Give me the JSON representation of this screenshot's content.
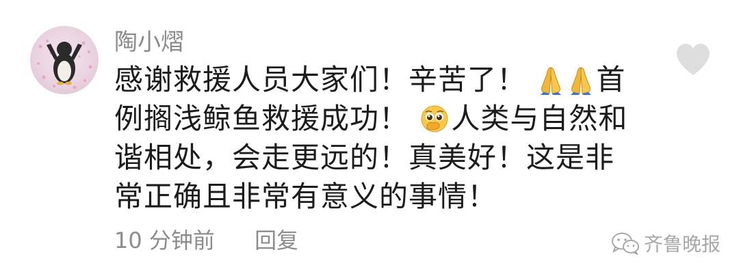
{
  "comment": {
    "username": "陶小熠",
    "text_parts": {
      "p1": "感谢救援人员大家们！辛苦了！",
      "p2": "首例搁浅鲸鱼救援成功！",
      "p3": "人类与自然和谐相处，会走更远的！真美好！这是非常正确且非常有意义的事情！"
    },
    "emojis": {
      "pray": "folded-hands",
      "moved": "pleading-face-hand-over-mouth"
    },
    "time": "10 分钟前",
    "reply_label": "回复",
    "like_icon": "heart-outline"
  },
  "watermark": {
    "label": "齐鲁晚报",
    "icon": "wechat-logo"
  },
  "colors": {
    "text": "#1c1c1c",
    "muted": "#8a8a8a",
    "heart": "#dedede",
    "background": "#ffffff"
  }
}
